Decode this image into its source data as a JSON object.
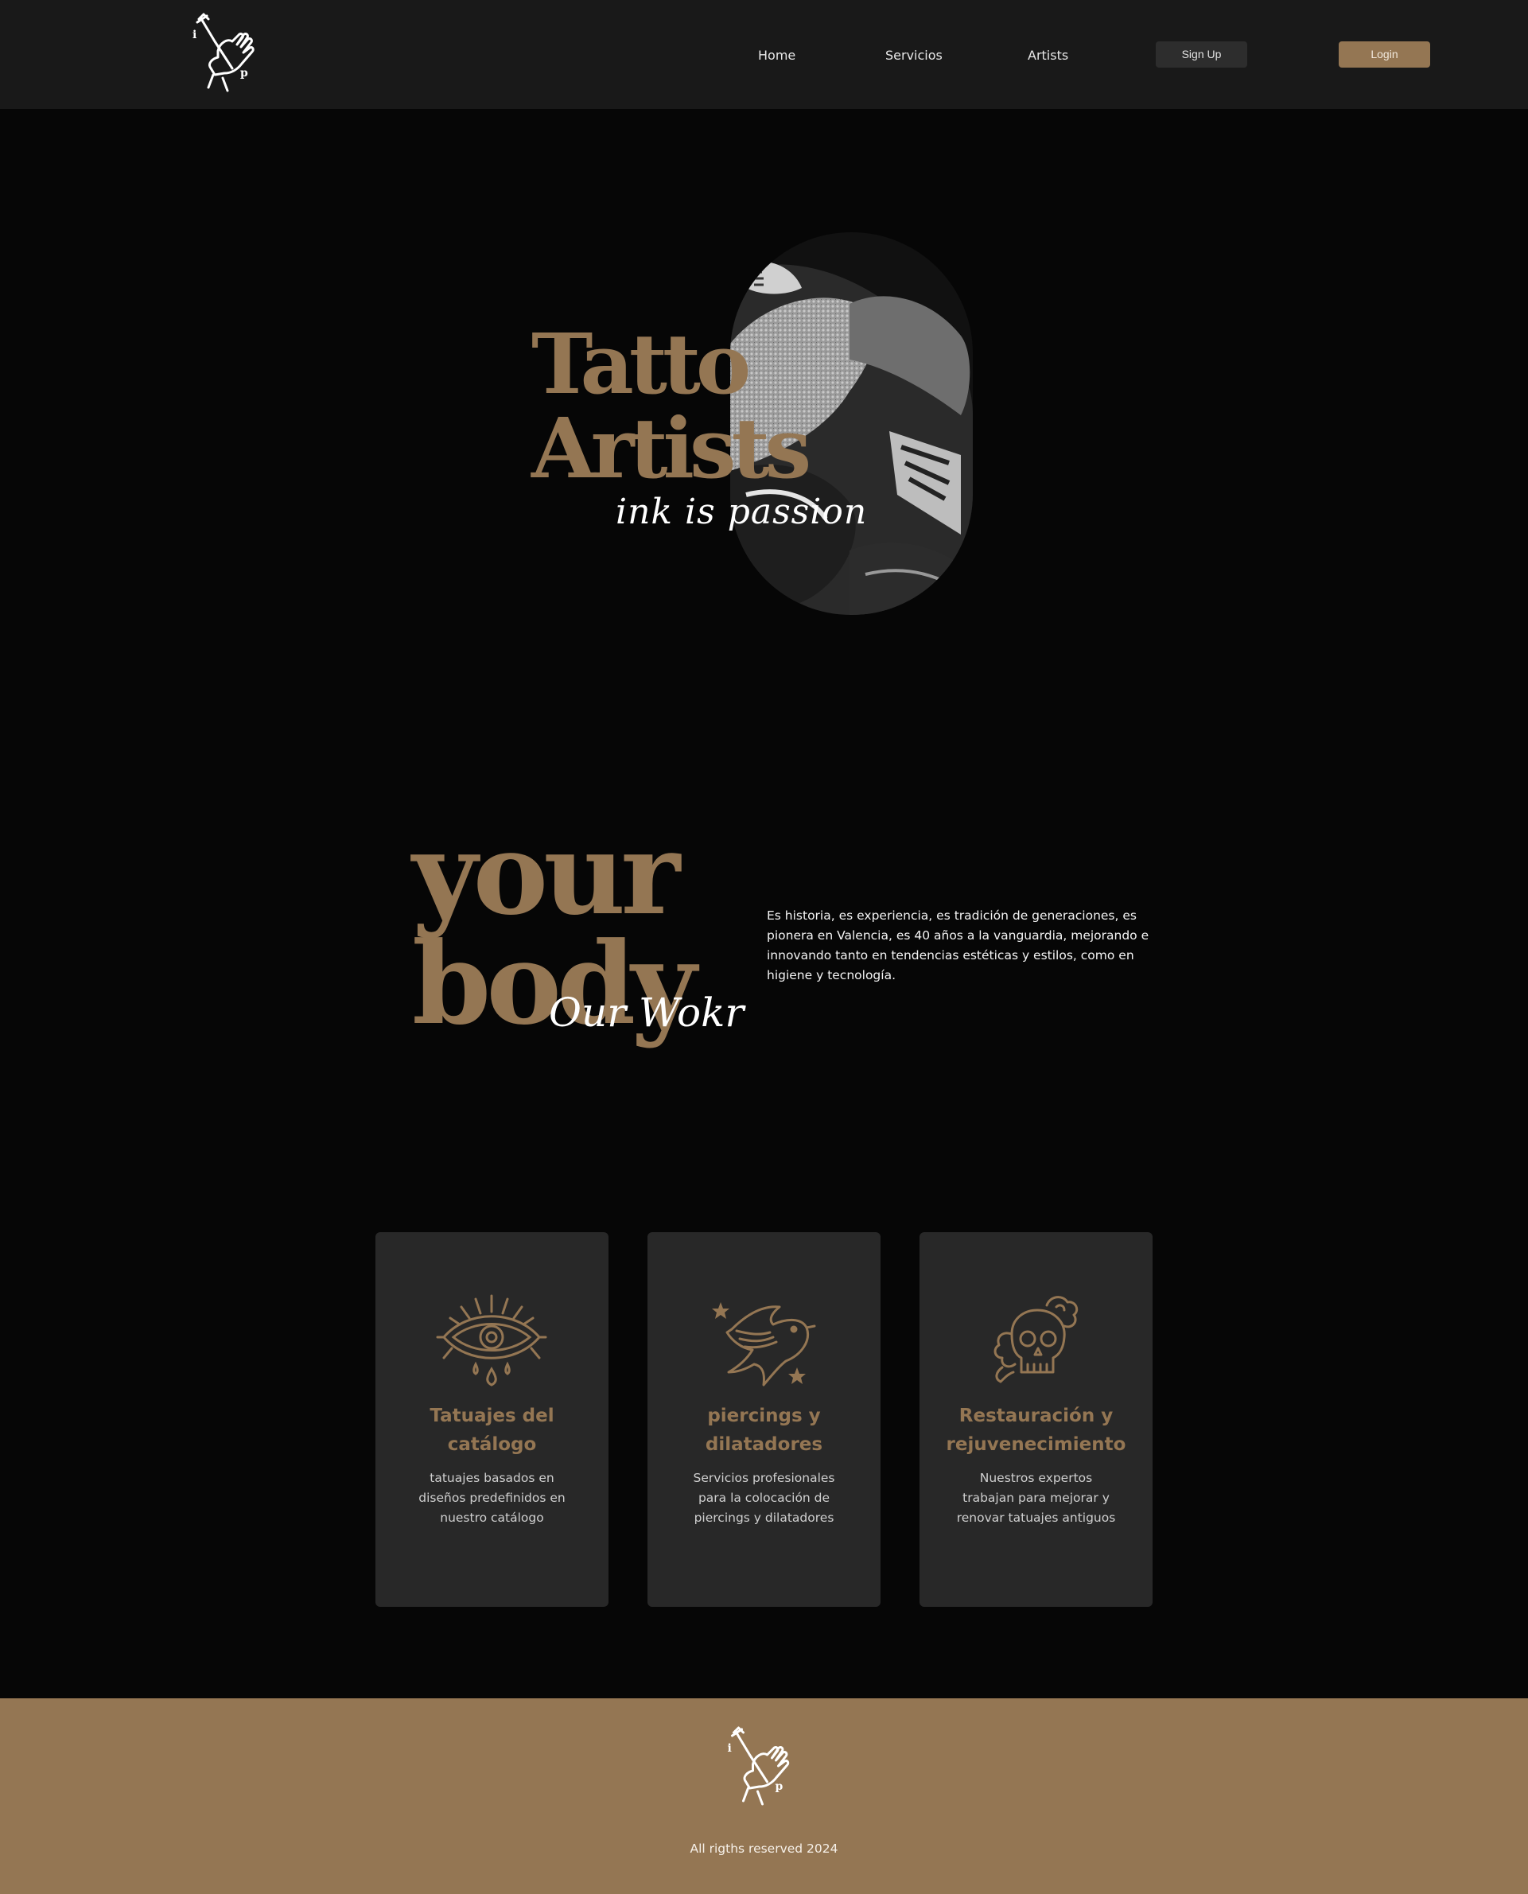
{
  "nav": {
    "links": [
      "Home",
      "Servicios",
      "Artists"
    ],
    "signup_label": "Sign Up",
    "login_label": "Login"
  },
  "hero": {
    "title_line1": "Tatto",
    "title_line2": "Artists",
    "script": "ink is passion"
  },
  "work": {
    "title_line1": "your",
    "title_line2": "body",
    "script": "Our Wokr",
    "text": "Es historia, es experiencia, es tradición de generaciones, es pionera en Valencia, es 40 años a la vanguardia, mejorando e innovando tanto en tendencias estéticas y estilos, como en higiene y tecnología."
  },
  "services": [
    {
      "icon": "eye-icon",
      "title": "Tatuajes del catálogo",
      "desc": "tatuajes basados en diseños predefinidos en nuestro catálogo"
    },
    {
      "icon": "swallow-icon",
      "title": "piercings y dilatadores",
      "desc": "Servicios profesionales para la colocación de piercings y dilatadores"
    },
    {
      "icon": "skull-icon",
      "title": "Restauración y rejuvenecimiento",
      "desc": "Nuestros expertos trabajan para mejorar y renovar tatuajes antiguos"
    }
  ],
  "footer": {
    "copyright": "All rigths reserved 2024"
  },
  "colors": {
    "accent": "#947653",
    "navbar": "#191919",
    "background": "#060606",
    "card": "#282828",
    "signup_button": "#2d2d2d"
  }
}
